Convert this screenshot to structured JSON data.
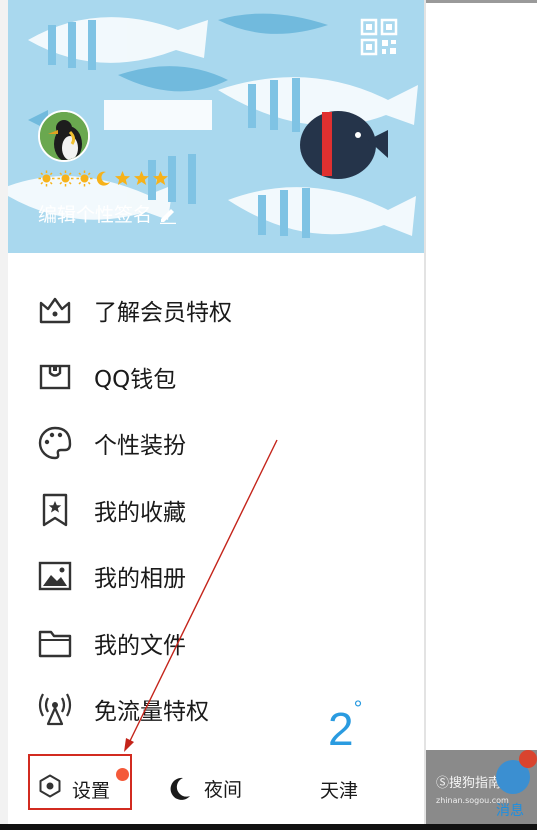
{
  "profile": {
    "signature": "编辑个性签名",
    "level_icons": [
      "sun-icon",
      "sun-icon",
      "sun-icon",
      "moon-icon",
      "star-icon",
      "star-icon",
      "star-icon"
    ]
  },
  "menu": {
    "items": [
      {
        "icon": "crown-icon",
        "label": "了解会员特权"
      },
      {
        "icon": "wallet-icon",
        "label": "QQ钱包"
      },
      {
        "icon": "palette-icon",
        "label": "个性装扮"
      },
      {
        "icon": "bookmark-star-icon",
        "label": "我的收藏"
      },
      {
        "icon": "image-icon",
        "label": "我的相册"
      },
      {
        "icon": "folder-icon",
        "label": "我的文件"
      },
      {
        "icon": "signal-icon",
        "label": "免流量特权"
      }
    ]
  },
  "footer": {
    "settings_label": "设置",
    "night_label": "夜间",
    "temperature": "2",
    "temperature_unit": "°",
    "city": "天津"
  },
  "right_pane": {
    "watermark": "搜狗指南",
    "watermark_url": "zhinan.sogou.com",
    "messages_label": "消息"
  },
  "colors": {
    "header_bg": "#a9d8ee",
    "accent_blue": "#2a9be0",
    "annotation_red": "#d22b20",
    "badge_red": "#f45a3a"
  }
}
